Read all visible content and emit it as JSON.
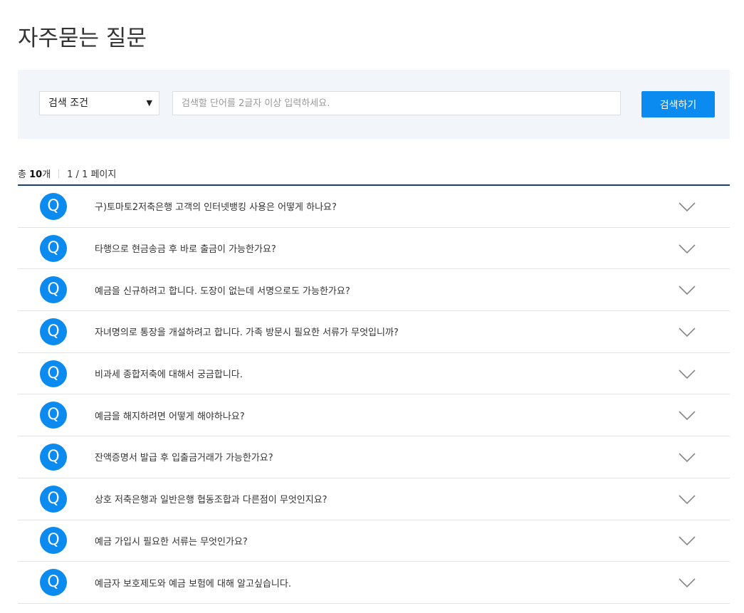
{
  "page": {
    "title": "자주묻는 질문"
  },
  "search": {
    "select_value": "검색 조건",
    "select_icon": "caret-down-icon",
    "placeholder": "검색할 단어를 2글자 이상 입력하세요.",
    "button_label": "검색하기"
  },
  "results": {
    "total_prefix": "총 ",
    "total_count": "10",
    "total_suffix": "개",
    "page_info": "1 / 1 페이지"
  },
  "faq": {
    "badge_label": "Q",
    "items": [
      {
        "question": "구)토마토2저축은행 고객의 인터넷뱅킹 사용은 어떻게 하나요?"
      },
      {
        "question": "타행으로 현금송금 후 바로 출금이 가능한가요?"
      },
      {
        "question": "예금을 신규하려고 합니다. 도장이 없는데 서명으로도 가능한가요?"
      },
      {
        "question": "자녀명의로 통장을 개설하려고 합니다. 가족 방문시 필요한 서류가 무엇입니까?"
      },
      {
        "question": "비과세 종합저축에 대해서 궁금합니다."
      },
      {
        "question": "예금을 해지하려면 어떻게 해야하나요?"
      },
      {
        "question": "잔액증명서 발급 후 입출금거래가 가능한가요?"
      },
      {
        "question": "상호 저축은행과 일반은행 협동조합과 다른점이 무엇인지요?"
      },
      {
        "question": "예금 가입시 필요한 서류는 무엇인가요?"
      },
      {
        "question": "예금자 보호제도와 예금 보험에 대해 알고싶습니다."
      }
    ]
  },
  "colors": {
    "accent": "#0b8af0",
    "panel_bg": "#f2f6fa",
    "list_top_border": "#1c3d6e",
    "divider": "#e3e3e3"
  }
}
